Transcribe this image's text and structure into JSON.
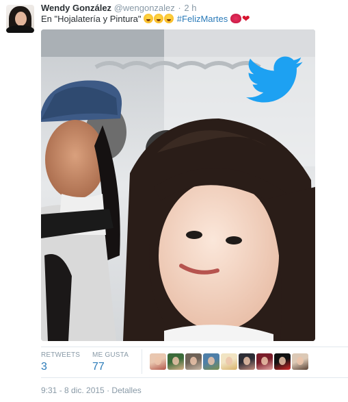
{
  "tweet": {
    "author": {
      "name": "Wendy González",
      "handle": "@wengonzalez",
      "time_ago": "2 h"
    },
    "text": {
      "before": "En \"Hojalatería y Pintura\"",
      "emojis_1": [
        "face-with-tears-of-joy-icon",
        "face-with-tears-of-joy-icon",
        "face-with-tears-of-joy-icon"
      ],
      "hashtag": "#FelizMartes",
      "emojis_2": [
        "kiss-mark-icon",
        "red-heart-icon"
      ]
    },
    "media": {
      "overlay_icon": "twitter-bird-icon",
      "overlay_color": "#1da1f2"
    },
    "stats": {
      "retweets_label": "RETWEETS",
      "retweets_value": "3",
      "likes_label": "ME GUSTA",
      "likes_value": "77"
    },
    "likers": [
      {
        "name": "liker-avatar-1",
        "colors": [
          "#e9c7b0",
          "#b2574a"
        ]
      },
      {
        "name": "liker-avatar-2",
        "colors": [
          "#3b6b3a",
          "#d9b08a"
        ]
      },
      {
        "name": "liker-avatar-3",
        "colors": [
          "#6e6257",
          "#c9b7a4"
        ]
      },
      {
        "name": "liker-avatar-4",
        "colors": [
          "#4e7fa8",
          "#7c8f4e"
        ]
      },
      {
        "name": "liker-avatar-5",
        "colors": [
          "#f1e4c3",
          "#d8b26a"
        ]
      },
      {
        "name": "liker-avatar-6",
        "colors": [
          "#2d2d35",
          "#c48d7e"
        ]
      },
      {
        "name": "liker-avatar-7",
        "colors": [
          "#7a1d2a",
          "#e5a7a3"
        ]
      },
      {
        "name": "liker-avatar-8",
        "colors": [
          "#111111",
          "#d82a2a"
        ]
      },
      {
        "name": "liker-avatar-9",
        "colors": [
          "#dcc9b6",
          "#5a4235"
        ]
      }
    ],
    "footer": {
      "time": "9:31 - 8 dic. 2015",
      "sep": "·",
      "details": "Detalles"
    }
  }
}
